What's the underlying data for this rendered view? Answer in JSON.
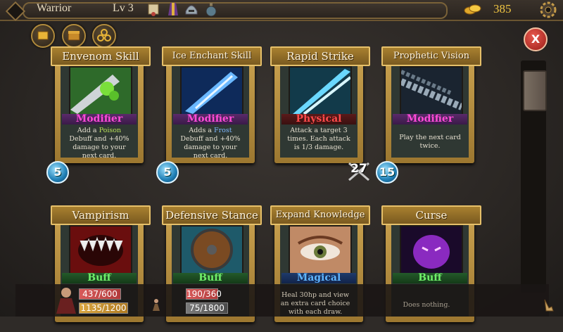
{
  "header": {
    "hero_name": "Warrior",
    "level": "Lv 3",
    "gold": "385",
    "equipment_icons": [
      "scroll-icon",
      "robe-icon",
      "helmet-icon",
      "potion-icon"
    ]
  },
  "filters": [
    {
      "icon": "gold-bars-icon"
    },
    {
      "icon": "chest-icon"
    },
    {
      "icon": "triskelion-icon"
    }
  ],
  "close_label": "X",
  "cards": [
    {
      "title": "Envenom Skill",
      "type": "Modifier",
      "desc_pre": "Add a ",
      "desc_hl": "Poison",
      "desc_post": " Debuff and +40% damage to your next card.",
      "cost": "5",
      "art": "poison-blade-art"
    },
    {
      "title": "Ice Enchant Skill",
      "type": "Modifier",
      "desc_pre": "Adds a ",
      "desc_hl": "Frost",
      "desc_post": " Debuff and +40% damage to your next card.",
      "cost": "5",
      "art": "frost-blade-art"
    },
    {
      "title": "Rapid Strike",
      "type": "Physical",
      "desc_pre": "Attack a target 3 times. Each attack is 1/3 damage.",
      "desc_hl": "",
      "desc_post": "",
      "damage": "27",
      "art": "ice-slash-art"
    },
    {
      "title": "Prophetic Vision",
      "type": "Modifier",
      "desc_pre": "Play the next card twice.",
      "desc_hl": "",
      "desc_post": "",
      "cost": "15",
      "art": "chain-art"
    },
    {
      "title": "Vampirism",
      "type": "Buff",
      "art": "fangs-art"
    },
    {
      "title": "Defensive Stance",
      "type": "Buff",
      "art": "shield-art"
    },
    {
      "title": "Expand Knowledge",
      "type": "Magical",
      "art": "eye-art"
    },
    {
      "title": "Curse",
      "type": "Buff",
      "art": "curse-art"
    }
  ],
  "bottom_bar": {
    "hero_hp": "437/600",
    "hero_xp": "1135/1200",
    "enemy_hp": "190/360",
    "enemy_xp": "75/1800",
    "card7_desc": "Heal 30hp and view an extra card choice with each draw.",
    "card8_desc": "Does nothing."
  },
  "colors": {
    "gold": "#f0c542",
    "modifier": "#ff4bd8",
    "physical": "#ff4a4a",
    "buff": "#6fef6a",
    "magical": "#5fb5ff"
  }
}
